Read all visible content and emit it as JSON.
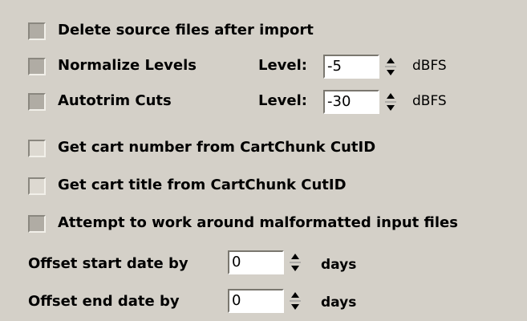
{
  "options": {
    "delete_source": "Delete source files after import",
    "normalize": "Normalize Levels",
    "autotrim": "Autotrim Cuts",
    "cart_number": "Get cart number from CartChunk CutID",
    "cart_title": "Get cart title from CartChunk CutID",
    "malformatted": "Attempt to work around malformatted input files"
  },
  "level_label": "Level:",
  "normalize_level": "-5",
  "autotrim_level": "-30",
  "level_unit": "dBFS",
  "offset_start_label": "Offset start date by",
  "offset_end_label": "Offset end date by",
  "offset_start_value": "0",
  "offset_end_value": "0",
  "offset_unit": "days"
}
